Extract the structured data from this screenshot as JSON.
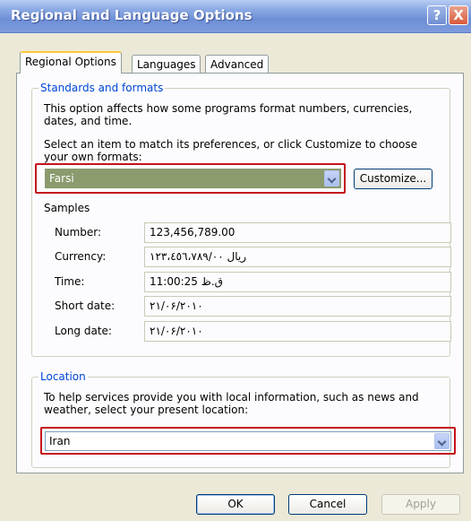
{
  "window": {
    "title": "Regional and Language Options"
  },
  "titlebar_buttons": {
    "help": "?",
    "close": "X"
  },
  "tabs": [
    {
      "label": "Regional Options",
      "active": true
    },
    {
      "label": "Languages",
      "active": false
    },
    {
      "label": "Advanced",
      "active": false
    }
  ],
  "standards": {
    "legend": "Standards and formats",
    "desc": "This option affects how some programs format numbers, currencies, dates, and time.",
    "select_prompt": "Select an item to match its preferences, or click Customize to choose your own formats:",
    "selected_format": "Farsi",
    "customize_label": "Customize..."
  },
  "samples": {
    "heading": "Samples",
    "rows": [
      {
        "label": "Number:",
        "value": "123,456,789.00"
      },
      {
        "label": "Currency:",
        "value": "ريال ١٢٣،٤٥٦،٧٨٩/٠٠"
      },
      {
        "label": "Time:",
        "value": "ق.ظ 11:00:25"
      },
      {
        "label": "Short date:",
        "value": "٢١/٠۶/٢٠١٠"
      },
      {
        "label": "Long date:",
        "value": "٢١/٠۶/٢٠١٠"
      }
    ]
  },
  "location": {
    "legend": "Location",
    "desc": "To help services provide you with local information, such as news and weather, select your present location:",
    "selected": "Iran"
  },
  "footer": {
    "ok": "OK",
    "cancel": "Cancel",
    "apply": "Apply"
  },
  "colors": {
    "highlight": "#c4131c",
    "selected_bg": "#8b9b6e",
    "legend": "#0046d5"
  }
}
